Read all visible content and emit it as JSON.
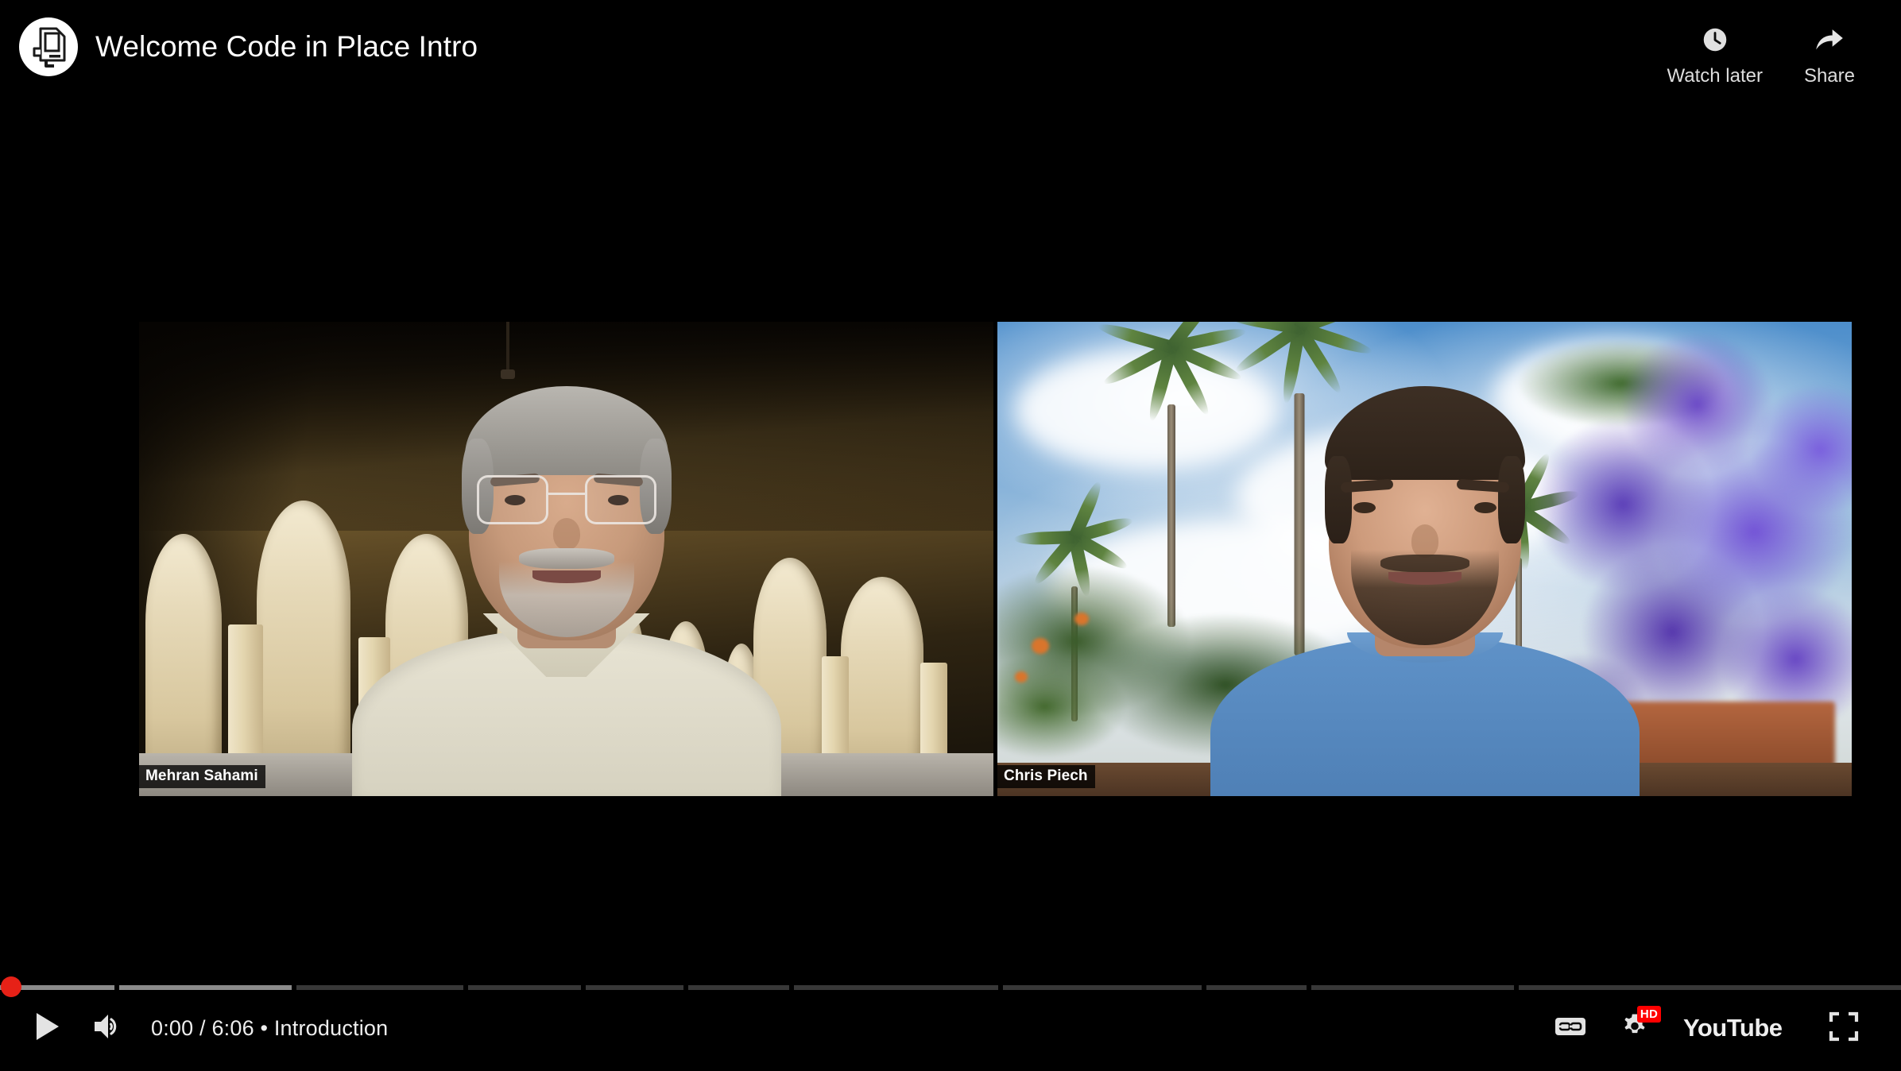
{
  "player": {
    "header": {
      "channel_avatar_icon": "code-in-place-logo-icon",
      "title": "Welcome Code in Place Intro",
      "actions": [
        {
          "icon": "clock-icon",
          "label": "Watch later"
        },
        {
          "icon": "share-arrow-icon",
          "label": "Share"
        }
      ]
    },
    "video": {
      "left_participant": {
        "name_label": "Mehran Sahami",
        "background": "stanford-sandstone-arcade"
      },
      "right_participant": {
        "name_label": "Chris Piech",
        "background": "palm-trees-and-jacaranda-sky"
      }
    },
    "controls": {
      "play_icon": "play-icon",
      "volume_icon": "volume-on-icon",
      "time_display": "0:00 / 6:06 • Introduction",
      "current_time": "0:00",
      "duration": "6:06",
      "chapter_name": "Introduction",
      "captions_icon": "closed-captions-icon",
      "settings_icon": "gear-icon",
      "quality_badge": "HD",
      "youtube_wordmark": "YouTube",
      "fullscreen_icon": "fullscreen-icon",
      "progress_percent": 0,
      "accent_color": "#f00",
      "chapters": [
        {
          "width_pct": 6.1,
          "buffer_pct": 100,
          "played_pct": 0
        },
        {
          "width_pct": 9.2,
          "buffer_pct": 100,
          "played_pct": 0
        },
        {
          "width_pct": 8.9,
          "buffer_pct": 0,
          "played_pct": 0
        },
        {
          "width_pct": 6.0,
          "buffer_pct": 0,
          "played_pct": 0
        },
        {
          "width_pct": 5.2,
          "buffer_pct": 0,
          "played_pct": 0
        },
        {
          "width_pct": 5.4,
          "buffer_pct": 0,
          "played_pct": 0
        },
        {
          "width_pct": 10.9,
          "buffer_pct": 0,
          "played_pct": 0
        },
        {
          "width_pct": 10.6,
          "buffer_pct": 0,
          "played_pct": 0
        },
        {
          "width_pct": 5.3,
          "buffer_pct": 0,
          "played_pct": 0
        },
        {
          "width_pct": 10.8,
          "buffer_pct": 0,
          "played_pct": 0
        },
        {
          "width_pct": 20.4,
          "buffer_pct": 0,
          "played_pct": 0
        }
      ]
    }
  }
}
